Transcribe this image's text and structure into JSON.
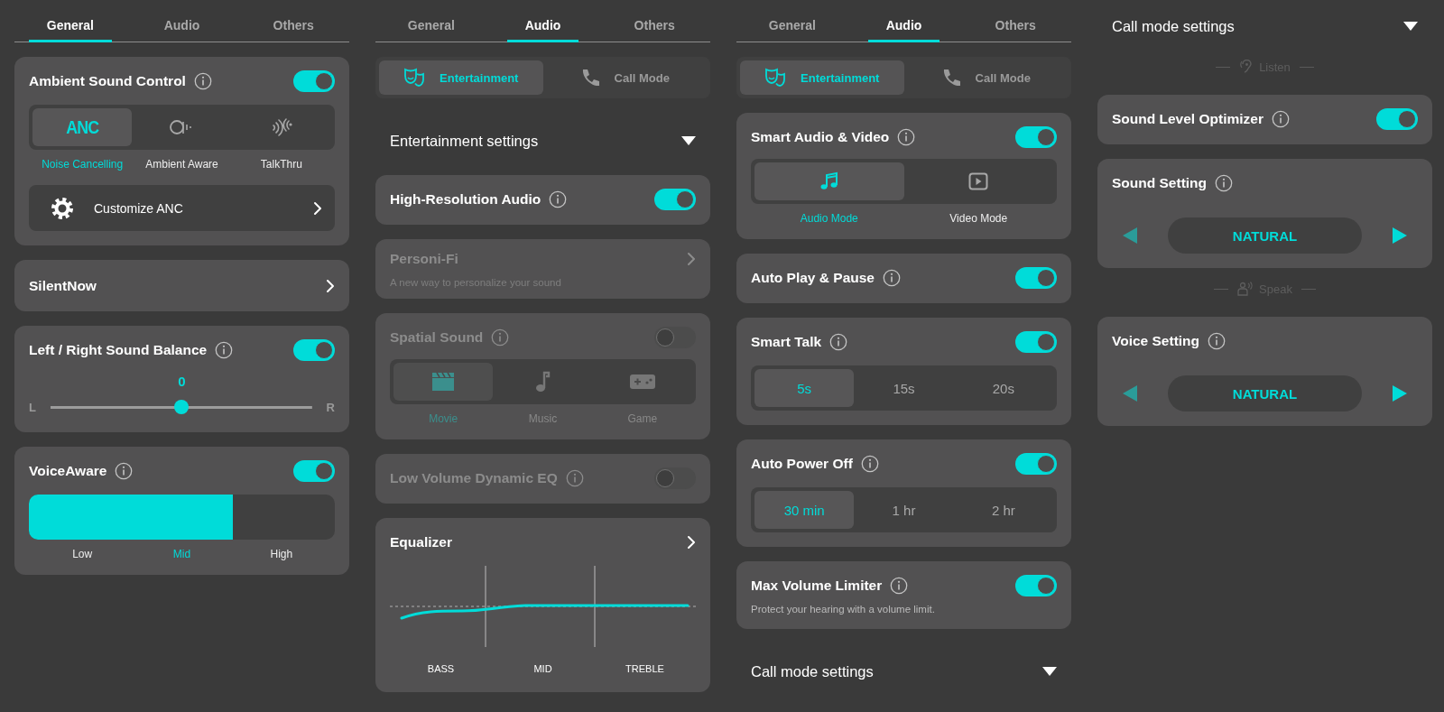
{
  "panels": [
    {
      "tabs": [
        {
          "label": "General",
          "selected": true
        },
        {
          "label": "Audio",
          "selected": false
        },
        {
          "label": "Others",
          "selected": false
        }
      ],
      "items": [
        {
          "kind": "anc-modes",
          "title": "Ambient Sound Control",
          "info": true,
          "on": true,
          "disabled": false,
          "options": [
            {
              "glyph": "ANC",
              "label": "Noise Cancelling",
              "selected": true
            },
            {
              "label": "Ambient Aware",
              "selected": false
            },
            {
              "label": "TalkThru",
              "selected": false
            }
          ],
          "link": "Customize ANC"
        },
        {
          "kind": "link",
          "title": "SilentNow",
          "disabled": false
        },
        {
          "kind": "balance",
          "title": "Left / Right Sound Balance",
          "info": true,
          "on": true,
          "disabled": false,
          "value": "0",
          "left": "L",
          "right": "R",
          "level": 0.5
        },
        {
          "kind": "level-select",
          "title": "VoiceAware",
          "info": true,
          "on": true,
          "disabled": false,
          "options": [
            {
              "label": "Low",
              "selected": false
            },
            {
              "label": "Mid",
              "selected": true
            },
            {
              "label": "High",
              "selected": false
            }
          ]
        }
      ]
    },
    {
      "tabs": [
        {
          "label": "General",
          "selected": false
        },
        {
          "label": "Audio",
          "selected": true
        },
        {
          "label": "Others",
          "selected": false
        }
      ],
      "subtabs": [
        {
          "label": "Entertainment",
          "selected": true
        },
        {
          "label": "Call Mode",
          "selected": false
        }
      ],
      "items": [
        {
          "kind": "header",
          "title": "Entertainment settings",
          "expanded": true
        },
        {
          "kind": "toggle",
          "title": "High-Resolution Audio",
          "info": true,
          "on": true,
          "disabled": false
        },
        {
          "kind": "link",
          "title": "Personi-Fi",
          "description": "A new way to personalize your sound",
          "disabled": true
        },
        {
          "kind": "spatial-modes",
          "title": "Spatial Sound",
          "info": true,
          "on": false,
          "disabled": true,
          "options": [
            {
              "label": "Movie",
              "selected": true
            },
            {
              "label": "Music",
              "selected": false
            },
            {
              "label": "Game",
              "selected": false
            }
          ]
        },
        {
          "kind": "toggle",
          "title": "Low Volume Dynamic EQ",
          "info": true,
          "on": false,
          "disabled": true
        },
        {
          "kind": "equalizer",
          "title": "Equalizer",
          "disabled": false,
          "bands": [
            "BASS",
            "MID",
            "TREBLE"
          ]
        }
      ]
    },
    {
      "tabs": [
        {
          "label": "General",
          "selected": false
        },
        {
          "label": "Audio",
          "selected": true
        },
        {
          "label": "Others",
          "selected": false
        }
      ],
      "subtabs": [
        {
          "label": "Entertainment",
          "selected": true
        },
        {
          "label": "Call Mode",
          "selected": false
        }
      ],
      "items": [
        {
          "kind": "av-modes",
          "title": "Smart Audio & Video",
          "info": true,
          "on": true,
          "disabled": false,
          "options": [
            {
              "label": "Audio Mode",
              "selected": true
            },
            {
              "label": "Video Mode",
              "selected": false
            }
          ]
        },
        {
          "kind": "toggle",
          "title": "Auto Play & Pause",
          "info": true,
          "on": true,
          "disabled": false
        },
        {
          "kind": "segments",
          "title": "Smart Talk",
          "info": true,
          "on": true,
          "disabled": false,
          "options": [
            {
              "label": "5s",
              "selected": true
            },
            {
              "label": "15s",
              "selected": false
            },
            {
              "label": "20s",
              "selected": false
            }
          ]
        },
        {
          "kind": "segments",
          "title": "Auto Power Off",
          "info": true,
          "on": true,
          "disabled": false,
          "options": [
            {
              "label": "30 min",
              "selected": true
            },
            {
              "label": "1 hr",
              "selected": false
            },
            {
              "label": "2 hr",
              "selected": false
            }
          ]
        },
        {
          "kind": "toggle",
          "title": "Max Volume Limiter",
          "info": true,
          "on": true,
          "disabled": false,
          "description": "Protect your hearing with a volume limit."
        },
        {
          "kind": "header",
          "title": "Call mode settings",
          "expanded": true
        }
      ]
    },
    {
      "items": [
        {
          "kind": "header",
          "title": "Call mode settings",
          "expanded": true
        },
        {
          "kind": "divider",
          "label": "Listen"
        },
        {
          "kind": "toggle",
          "title": "Sound Level Optimizer",
          "info": true,
          "on": true,
          "disabled": false
        },
        {
          "kind": "stepper",
          "title": "Sound Setting",
          "info": true,
          "disabled": false,
          "value": "NATURAL"
        },
        {
          "kind": "divider",
          "label": "Speak"
        },
        {
          "kind": "stepper",
          "title": "Voice Setting",
          "info": true,
          "disabled": false,
          "value": "NATURAL"
        }
      ]
    }
  ]
}
